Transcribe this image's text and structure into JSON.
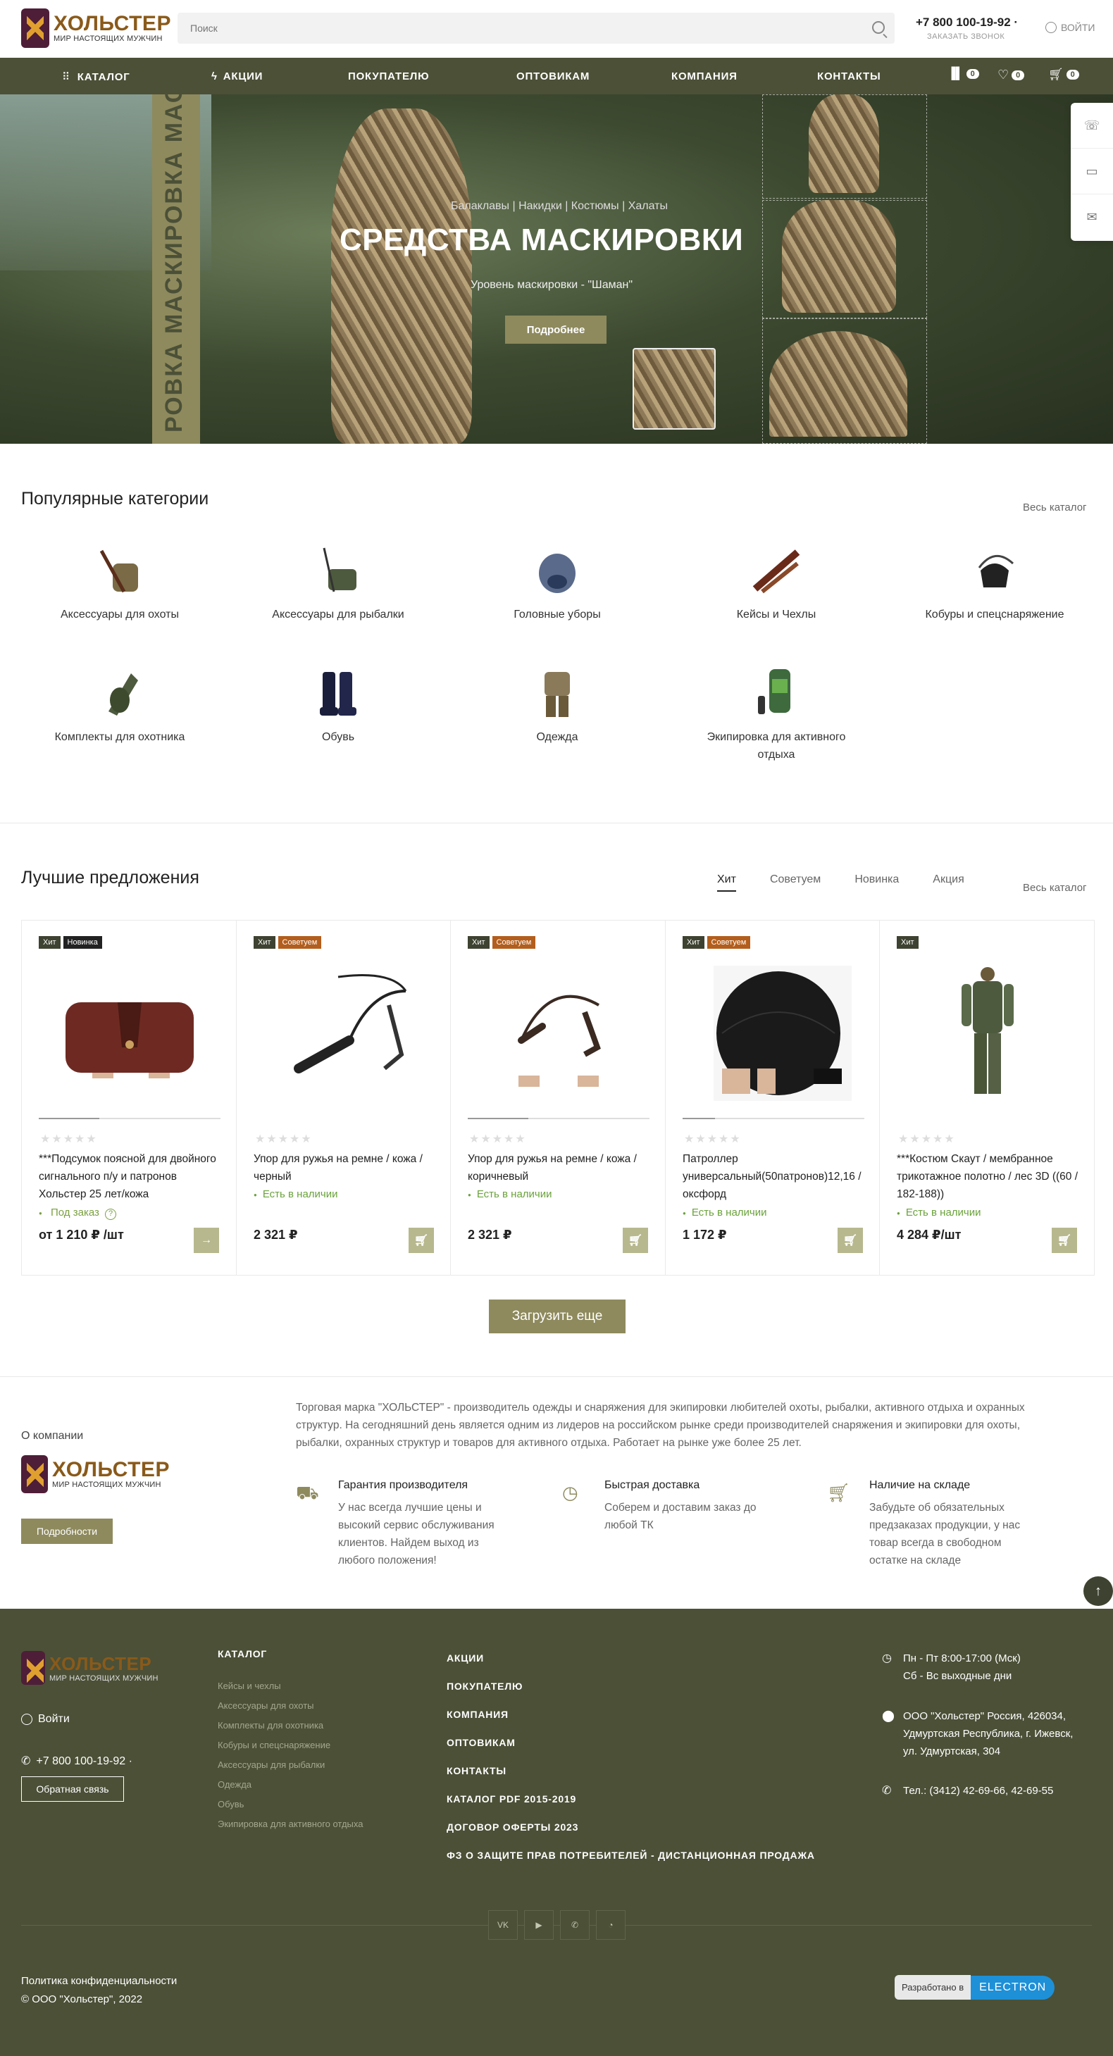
{
  "header": {
    "brand_name": "ХОЛЬСТЕР",
    "brand_slogan": "МИР НАСТОЯЩИХ МУЖЧИН",
    "search_placeholder": "Поиск",
    "phone": "+7 800 100-19-92 ·",
    "callback": "ЗАКАЗАТЬ ЗВОНОК",
    "login": "ВОЙТИ"
  },
  "nav": {
    "items": [
      "КАТАЛОГ",
      "АКЦИИ",
      "ПОКУПАТЕЛЮ",
      "ОПТОВИКАМ",
      "КОМПАНИЯ",
      "КОНТАКТЫ"
    ],
    "compare_count": "0",
    "favorites_count": "0",
    "cart_count": "0"
  },
  "hero": {
    "vertical_text": "РОВКА МАСКИРОВКА МАСКИРОВ",
    "subtitle": "Балаклавы | Накидки | Костюмы | Халаты",
    "title": "СРЕДСТВА МАСКИРОВКИ",
    "level": "Уровень маскировки - \"Шаман\"",
    "button": "Подробнее",
    "slides": 4,
    "active_slide": 1
  },
  "popular": {
    "title": "Популярные категории",
    "all_link": "Весь каталог",
    "categories": [
      "Аксессуары для охоты",
      "Аксессуары для рыбалки",
      "Головные уборы",
      "Кейсы и Чехлы",
      "Кобуры и спецснаряжение",
      "Комплекты для охотника",
      "Обувь",
      "Одежда",
      "Экипировка для активного отдыха"
    ]
  },
  "offers": {
    "title": "Лучшие предложения",
    "tabs": [
      "Хит",
      "Советуем",
      "Новинка",
      "Акция"
    ],
    "active_tab": "Хит",
    "all_link": "Весь каталог",
    "load_more": "Загрузить еще",
    "products": [
      {
        "tags": [
          "Хит",
          "Новинка"
        ],
        "name": "***Подсумок поясной для двойного сигнального п/у и патронов Хольстер 25 лет/кожа",
        "availability": "Под заказ",
        "price": "от 1 210 ₽ /шт",
        "rating": 0
      },
      {
        "tags": [
          "Хит",
          "Советуем"
        ],
        "name": "Упор для ружья на ремне / кожа / черный",
        "availability": "Есть в наличии",
        "price": "2 321 ₽",
        "rating": 0
      },
      {
        "tags": [
          "Хит",
          "Советуем"
        ],
        "name": "Упор для ружья на ремне / кожа / коричневый",
        "availability": "Есть в наличии",
        "price": "2 321 ₽",
        "rating": 0
      },
      {
        "tags": [
          "Хит",
          "Советуем"
        ],
        "name": "Патроллер универсальный(50патронов)12,16 / оксфорд",
        "availability": "Есть в наличии",
        "price": "1 172 ₽",
        "rating": 0
      },
      {
        "tags": [
          "Хит"
        ],
        "name": "***Костюм Скаут / мембранное трикотажное полотно / лес 3D ((60 / 182-188))",
        "availability": "Есть в наличии",
        "price": "4 284 ₽/шт",
        "rating": 0
      }
    ]
  },
  "about": {
    "label": "О компании",
    "button": "Подробности",
    "text": "Торговая марка \"ХОЛЬСТЕР\" - производитель одежды и снаряжения для экипировки любителей охоты, рыбалки, активного отдыха и охранных структур. На сегодняшний день является одним из лидеров на российском рынке среди производителей снаряжения и экипировки для охоты, рыбалки, охранных структур и товаров для активного отдыха. Работает на рынке уже более 25 лет.",
    "features": [
      {
        "title": "Гарантия производителя",
        "text": "У нас всегда лучшие цены и высокий сервис обслуживания клиентов. Найдем выход из любого положения!"
      },
      {
        "title": "Быстрая доставка",
        "text": "Соберем и доставим заказ до любой ТК"
      },
      {
        "title": "Наличие на складе",
        "text": "Забудьте об обязательных предзаказах продукции, у нас товар всегда в свободном остатке на складе"
      }
    ]
  },
  "footer": {
    "login": "Войти",
    "phone": "+7 800 100-19-92 ·",
    "feedback": "Обратная связь",
    "catalog_title": "КАТАЛОГ",
    "catalog_items": [
      "Кейсы и чехлы",
      "Аксессуары для охоты",
      "Комплекты для охотника",
      "Кобуры и спецснаряжение",
      "Аксессуары для рыбалки",
      "Одежда",
      "Обувь",
      "Экипировка для активного отдыха"
    ],
    "menu": [
      "АКЦИИ",
      "ПОКУПАТЕЛЮ",
      "КОМПАНИЯ",
      "ОПТОВИКАМ",
      "КОНТАКТЫ",
      "КАТАЛОГ PDF 2015-2019",
      "ДОГОВОР ОФЕРТЫ 2023",
      "ФЗ О ЗАЩИТЕ ПРАВ ПОТРЕБИТЕЛЕЙ - ДИСТАНЦИОННАЯ ПРОДАЖА"
    ],
    "hours_1": "Пн - Пт 8:00-17:00 (Мск)",
    "hours_2": "Сб - Вс выходные дни",
    "address_1": "ООО \"Хольстер\" Россия, 426034,",
    "address_2": "Удмуртская Республика, г. Ижевск,",
    "address_3": "ул. Удмуртская, 304",
    "tel": "Тел.: (3412) 42-69-66, 42-69-55",
    "privacy": "Политика конфиденциальности",
    "copyright": "© ООО \"Хольстер\", 2022",
    "developed_by": "Разработано в",
    "developer": "ELECTRON"
  },
  "colors": {
    "brand_olive": "#4b5037",
    "accent": "#8e8a5d",
    "logo_maroon": "#4e1e38",
    "logo_gold": "#8a5a1a"
  }
}
